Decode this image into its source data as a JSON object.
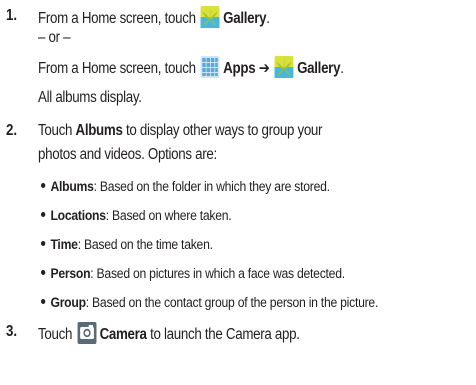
{
  "steps": [
    {
      "number": "1.",
      "first_prefix": "From a Home screen, touch",
      "first_target": "Gallery",
      "first_end": ".",
      "or": "– or –",
      "alt_prefix": "From a Home screen, touch",
      "alt_apps": "Apps",
      "alt_arrow": "➔",
      "alt_target": "Gallery",
      "alt_end": ".",
      "result": "All albums display."
    },
    {
      "number": "2.",
      "lead_word": "Touch",
      "lead_target": "Albums",
      "lead_rest": "to display other ways to group your",
      "line2": "photos and videos. Options are:",
      "options": [
        {
          "name": "Albums",
          "desc": ": Based on the folder in which they are stored."
        },
        {
          "name": "Locations",
          "desc": ": Based on where taken."
        },
        {
          "name": "Time",
          "desc": ": Based on the time taken."
        },
        {
          "name": "Person",
          "desc": ": Based on pictures in which a face was detected."
        },
        {
          "name": "Group",
          "desc": ": Based on the contact group of the person in the picture."
        }
      ]
    },
    {
      "number": "3.",
      "lead_word": "Touch",
      "target": "Camera",
      "rest": "to launch the Camera app."
    }
  ],
  "icons": {
    "gallery": "gallery-icon",
    "apps": "apps-grid-icon",
    "camera": "camera-icon"
  },
  "colors": {
    "text": "#231f20",
    "gallery_yellow": "#d8e23a",
    "gallery_blue": "#48b6e0",
    "apps_blue": "#5aa9dc",
    "camera_gray": "#5b6a75"
  }
}
